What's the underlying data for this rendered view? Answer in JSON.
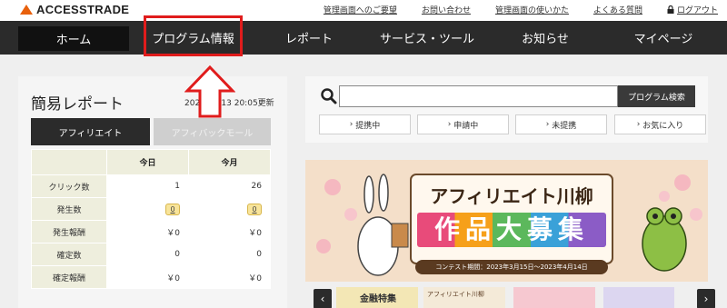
{
  "brand": {
    "name": "ACCESSTRADE"
  },
  "toplinks": [
    {
      "label": "管理画面へのご要望"
    },
    {
      "label": "お問い合わせ"
    },
    {
      "label": "管理画面の使いかた"
    },
    {
      "label": "よくある質問"
    },
    {
      "label": "ログアウト",
      "icon": "lock-icon"
    }
  ],
  "nav": {
    "home": "ホーム",
    "program": "プログラム情報",
    "report": "レポート",
    "service": "サービス・ツール",
    "news": "お知らせ",
    "mypage": "マイページ"
  },
  "report": {
    "title": "簡易レポート",
    "updated": "2023/03/13 20:05更新",
    "tab_active": "アフィリエイト",
    "tab_inactive": "アフィバックモール",
    "col_today": "今日",
    "col_month": "今月",
    "rows": [
      {
        "label": "クリック数",
        "today": "1",
        "month": "26"
      },
      {
        "label": "発生数",
        "today": "0",
        "month": "0"
      },
      {
        "label": "発生報酬",
        "today": "￥0",
        "month": "￥0"
      },
      {
        "label": "確定数",
        "today": "0",
        "month": "0"
      },
      {
        "label": "確定報酬",
        "today": "￥0",
        "month": "￥0"
      }
    ]
  },
  "search": {
    "value": "",
    "button": "プログラム検索",
    "filters": [
      "提携中",
      "申請中",
      "未提携",
      "お気に入り"
    ]
  },
  "banner": {
    "title": "アフィリエイト川柳",
    "subtitle": "作品大募集",
    "period": "コンテスト期間：2023年3月15日～2023年4月14日"
  },
  "carousel": {
    "thumb1": "金融特集",
    "thumb2": "アフィリエイト川柳",
    "prev": "‹",
    "next": "›"
  },
  "colors": {
    "accent": "#e8600c",
    "nav_bg": "#2b2b2b",
    "highlight": "#e01c1c",
    "badge": "#f8e49a"
  }
}
